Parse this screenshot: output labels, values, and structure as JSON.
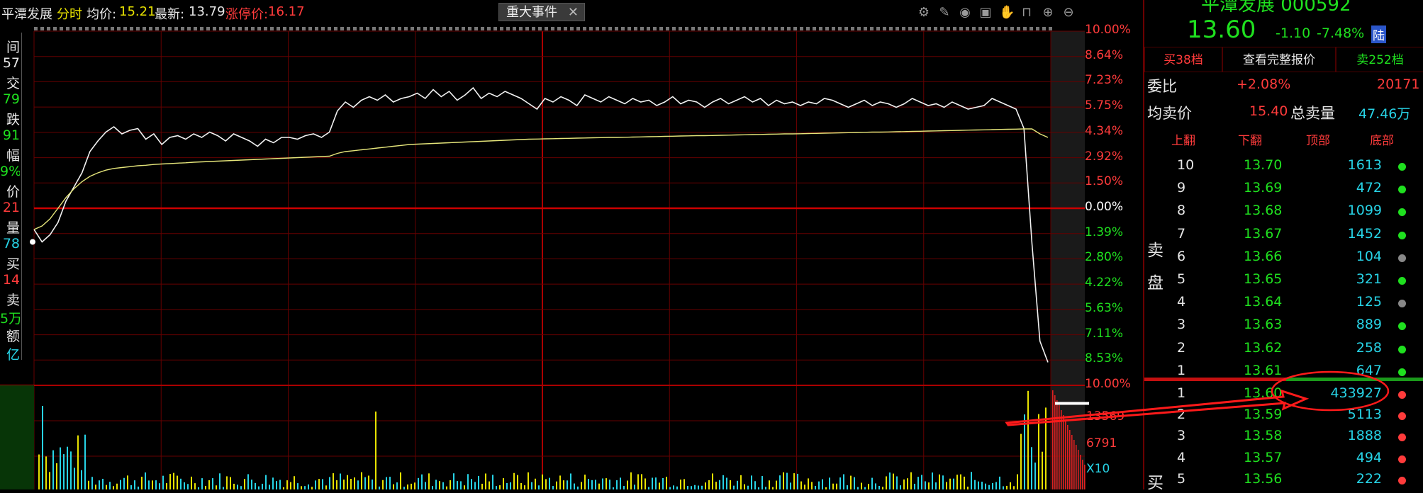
{
  "header": {
    "stock_name": "平潭发展",
    "mode": "分时",
    "avg_label": "均价:",
    "avg_value": "15.21",
    "last_label": "最新:",
    "last_value": "13.79",
    "limit_label": "涨停价:",
    "limit_value": "16.17",
    "event_button": "重大事件",
    "event_close": "✕",
    "icons": [
      "gear-icon",
      "pen-icon",
      "eye-icon",
      "briefcase-icon",
      "hand-icon",
      "lock-icon",
      "zoom-in-icon",
      "zoom-out-icon"
    ]
  },
  "left_panel": {
    "labels": [
      "间",
      "57",
      "交",
      "79",
      "跌",
      "91",
      "幅",
      "9%",
      "价",
      "21",
      "量",
      "78",
      "买",
      "14",
      "卖",
      "5万",
      "额",
      "亿"
    ],
    "colors": [
      "#e6e6e6",
      "#e6e6e6",
      "#e6e6e6",
      "#1fe01f",
      "#e6e6e6",
      "#1fe01f",
      "#e6e6e6",
      "#1fe01f",
      "#e6e6e6",
      "#ff3b3b",
      "#e6e6e6",
      "#27d3e6",
      "#e6e6e6",
      "#ff3b3b",
      "#e6e6e6",
      "#1fe01f",
      "#e6e6e6",
      "#27d3e6"
    ]
  },
  "price_axis": {
    "upper": [
      "10.00%",
      "8.64%",
      "7.23%",
      "5.75%",
      "4.34%",
      "2.92%",
      "1.50%",
      "0.00%"
    ],
    "lower": [
      "1.39%",
      "2.80%",
      "4.22%",
      "5.63%",
      "7.11%",
      "8.53%",
      "10.00%"
    ]
  },
  "volume_axis": {
    "labels": [
      "13569",
      "6791",
      "X10"
    ]
  },
  "chart_data": {
    "type": "line",
    "series": [
      {
        "values_pct": [
          -1.2,
          -1.9,
          -1.5,
          -0.8,
          0.4,
          1.2,
          2.0,
          3.2,
          3.8,
          4.3,
          4.6,
          4.2,
          4.4,
          4.5,
          3.9,
          4.2,
          3.6,
          4.0,
          4.1,
          3.9,
          4.2,
          4.0,
          4.3,
          4.1,
          3.8,
          4.2,
          4.0,
          3.8,
          3.5,
          3.9,
          3.7,
          4.0,
          4.0,
          3.9,
          4.1,
          4.2,
          4.0,
          4.3,
          5.5,
          6.0,
          5.7,
          6.1,
          6.3,
          6.1,
          6.4,
          6.0,
          6.2,
          6.3,
          6.5,
          6.2,
          6.7,
          6.3,
          6.6,
          6.1,
          6.4,
          6.8,
          6.2,
          6.5,
          6.3,
          6.6,
          6.4,
          6.2,
          5.9,
          5.6,
          6.2,
          6.0,
          6.3,
          6.1,
          5.8,
          6.4,
          6.2,
          6.0,
          6.3,
          6.1,
          5.9,
          6.2,
          6.0,
          6.1,
          5.8,
          6.0,
          6.3,
          5.9,
          6.1,
          6.0,
          5.7,
          6.0,
          6.2,
          5.9,
          6.1,
          6.3,
          6.0,
          6.2,
          5.8,
          6.1,
          5.9,
          6.0,
          5.8,
          6.0,
          5.9,
          6.2,
          6.1,
          5.9,
          5.7,
          5.9,
          6.1,
          5.8,
          6.0,
          5.9,
          5.7,
          5.9,
          6.2,
          6.0,
          5.8,
          5.9,
          5.7,
          6.0,
          5.8,
          5.6,
          5.7,
          5.8,
          6.2,
          6.0,
          5.8,
          5.6,
          4.5,
          -2.0,
          -7.5,
          -8.7
        ]
      },
      {
        "values_pct": [
          -1.2,
          -1.0,
          -0.6,
          0.0,
          0.6,
          1.1,
          1.5,
          1.8,
          2.0,
          2.15,
          2.25,
          2.3,
          2.35,
          2.4,
          2.43,
          2.47,
          2.5,
          2.52,
          2.55,
          2.57,
          2.6,
          2.62,
          2.64,
          2.66,
          2.68,
          2.7,
          2.72,
          2.74,
          2.76,
          2.78,
          2.8,
          2.82,
          2.84,
          2.86,
          2.88,
          2.9,
          2.92,
          2.94,
          3.1,
          3.2,
          3.25,
          3.3,
          3.35,
          3.4,
          3.45,
          3.5,
          3.55,
          3.6,
          3.62,
          3.64,
          3.66,
          3.68,
          3.7,
          3.72,
          3.74,
          3.76,
          3.78,
          3.8,
          3.82,
          3.84,
          3.86,
          3.88,
          3.9,
          3.91,
          3.92,
          3.93,
          3.94,
          3.95,
          3.96,
          3.97,
          3.98,
          3.99,
          4.0,
          4.0,
          4.01,
          4.02,
          4.03,
          4.04,
          4.05,
          4.06,
          4.07,
          4.08,
          4.09,
          4.1,
          4.1,
          4.11,
          4.12,
          4.13,
          4.14,
          4.15,
          4.16,
          4.17,
          4.18,
          4.19,
          4.2,
          4.2,
          4.21,
          4.22,
          4.23,
          4.24,
          4.25,
          4.26,
          4.27,
          4.28,
          4.29,
          4.3,
          4.3,
          4.31,
          4.32,
          4.33,
          4.34,
          4.35,
          4.36,
          4.37,
          4.38,
          4.39,
          4.4,
          4.41,
          4.42,
          4.43,
          4.44,
          4.45,
          4.46,
          4.47,
          4.48,
          4.48,
          4.2,
          4.0
        ]
      }
    ],
    "ylim": [
      -10,
      10
    ],
    "grid": true
  },
  "right_panel": {
    "title": "平潭发展 000592",
    "price": "13.60",
    "change": "-1.10",
    "change_pct": "-7.48%",
    "badge": "陆",
    "buy_tab": "买38档",
    "full_quote": "查看完整报价",
    "sell_tab": "卖252档",
    "ratio_label": "委比",
    "ratio_value": "+2.08%",
    "ratio_volume": "20171",
    "avg_sell_label": "均卖价",
    "avg_sell_value": "15.40",
    "total_sell_label": "总卖量",
    "total_sell_value": "47.46万",
    "col_headers": [
      "上翻",
      "下翻",
      "顶部",
      "底部"
    ],
    "sell_side_label": [
      "卖",
      "盘"
    ],
    "buy_side_label": "买",
    "asks": [
      {
        "level": "10",
        "price": "13.70",
        "volume": "1613",
        "dot": "#1fe01f"
      },
      {
        "level": "9",
        "price": "13.69",
        "volume": "472",
        "dot": "#1fe01f"
      },
      {
        "level": "8",
        "price": "13.68",
        "volume": "1099",
        "dot": "#1fe01f"
      },
      {
        "level": "7",
        "price": "13.67",
        "volume": "1452",
        "dot": "#1fe01f"
      },
      {
        "level": "6",
        "price": "13.66",
        "volume": "104",
        "dot": "#888888"
      },
      {
        "level": "5",
        "price": "13.65",
        "volume": "321",
        "dot": "#1fe01f"
      },
      {
        "level": "4",
        "price": "13.64",
        "volume": "125",
        "dot": "#888888"
      },
      {
        "level": "3",
        "price": "13.63",
        "volume": "889",
        "dot": "#1fe01f"
      },
      {
        "level": "2",
        "price": "13.62",
        "volume": "258",
        "dot": "#1fe01f"
      },
      {
        "level": "1",
        "price": "13.61",
        "volume": "647",
        "dot": "#1fe01f"
      }
    ],
    "bids": [
      {
        "level": "1",
        "price": "13.60",
        "volume": "433927",
        "dot": "#ff3b3b"
      },
      {
        "level": "2",
        "price": "13.59",
        "volume": "5113",
        "dot": "#ff3b3b"
      },
      {
        "level": "3",
        "price": "13.58",
        "volume": "1888",
        "dot": "#ff3b3b"
      },
      {
        "level": "4",
        "price": "13.57",
        "volume": "494",
        "dot": "#ff3b3b"
      },
      {
        "level": "5",
        "price": "13.56",
        "volume": "222",
        "dot": "#ff3b3b"
      }
    ]
  }
}
